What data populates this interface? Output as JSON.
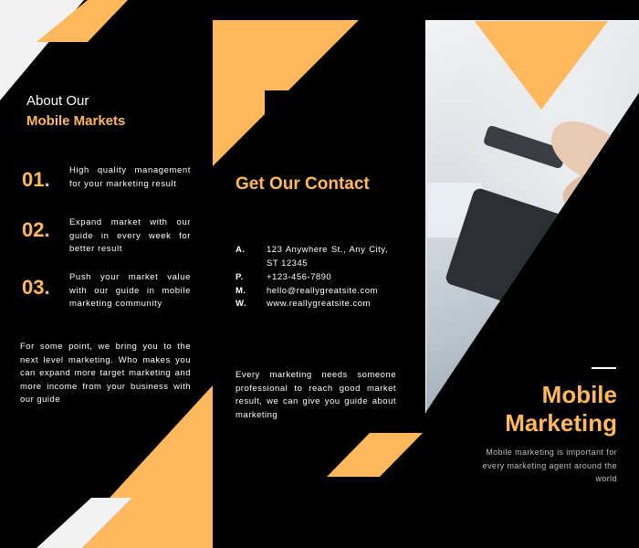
{
  "colors": {
    "background": "#000000",
    "accent": "#ffb95c",
    "text": "#ffffff",
    "muted": "#bfbfbf",
    "light_shape": "#f2f2f2"
  },
  "panel_left": {
    "title_line1": "About Our",
    "title_line2": "Mobile Markets",
    "points": [
      {
        "number": "01.",
        "text": "High quality management for your marketing result"
      },
      {
        "number": "02.",
        "text": "Expand market with our guide in every week for better result"
      },
      {
        "number": "03.",
        "text": "Push your market value with our guide in mobile marketing community"
      }
    ],
    "paragraph": "For some point, we bring you to the next level marketing. Who makes you can expand more target marketing and more income from your business with our guide"
  },
  "panel_middle": {
    "title": "Get Our Contact",
    "contacts": [
      {
        "label": "A.",
        "value": "123 Anywhere St., Any City, ST 12345"
      },
      {
        "label": "P.",
        "value": "+123-456-7890"
      },
      {
        "label": "M.",
        "value": "hello@reallygreatsite.com"
      },
      {
        "label": "W.",
        "value": "www.reallygreatsite.com"
      }
    ],
    "paragraph": "Every marketing needs someone professional to reach good market result, we can give you guide about marketing"
  },
  "panel_right": {
    "photo_icon": "mobile-marketing-photo",
    "title_line1": "Mobile",
    "title_line2": "Marketing",
    "description": "Mobile marketing is important for every marketing agent around the world"
  }
}
